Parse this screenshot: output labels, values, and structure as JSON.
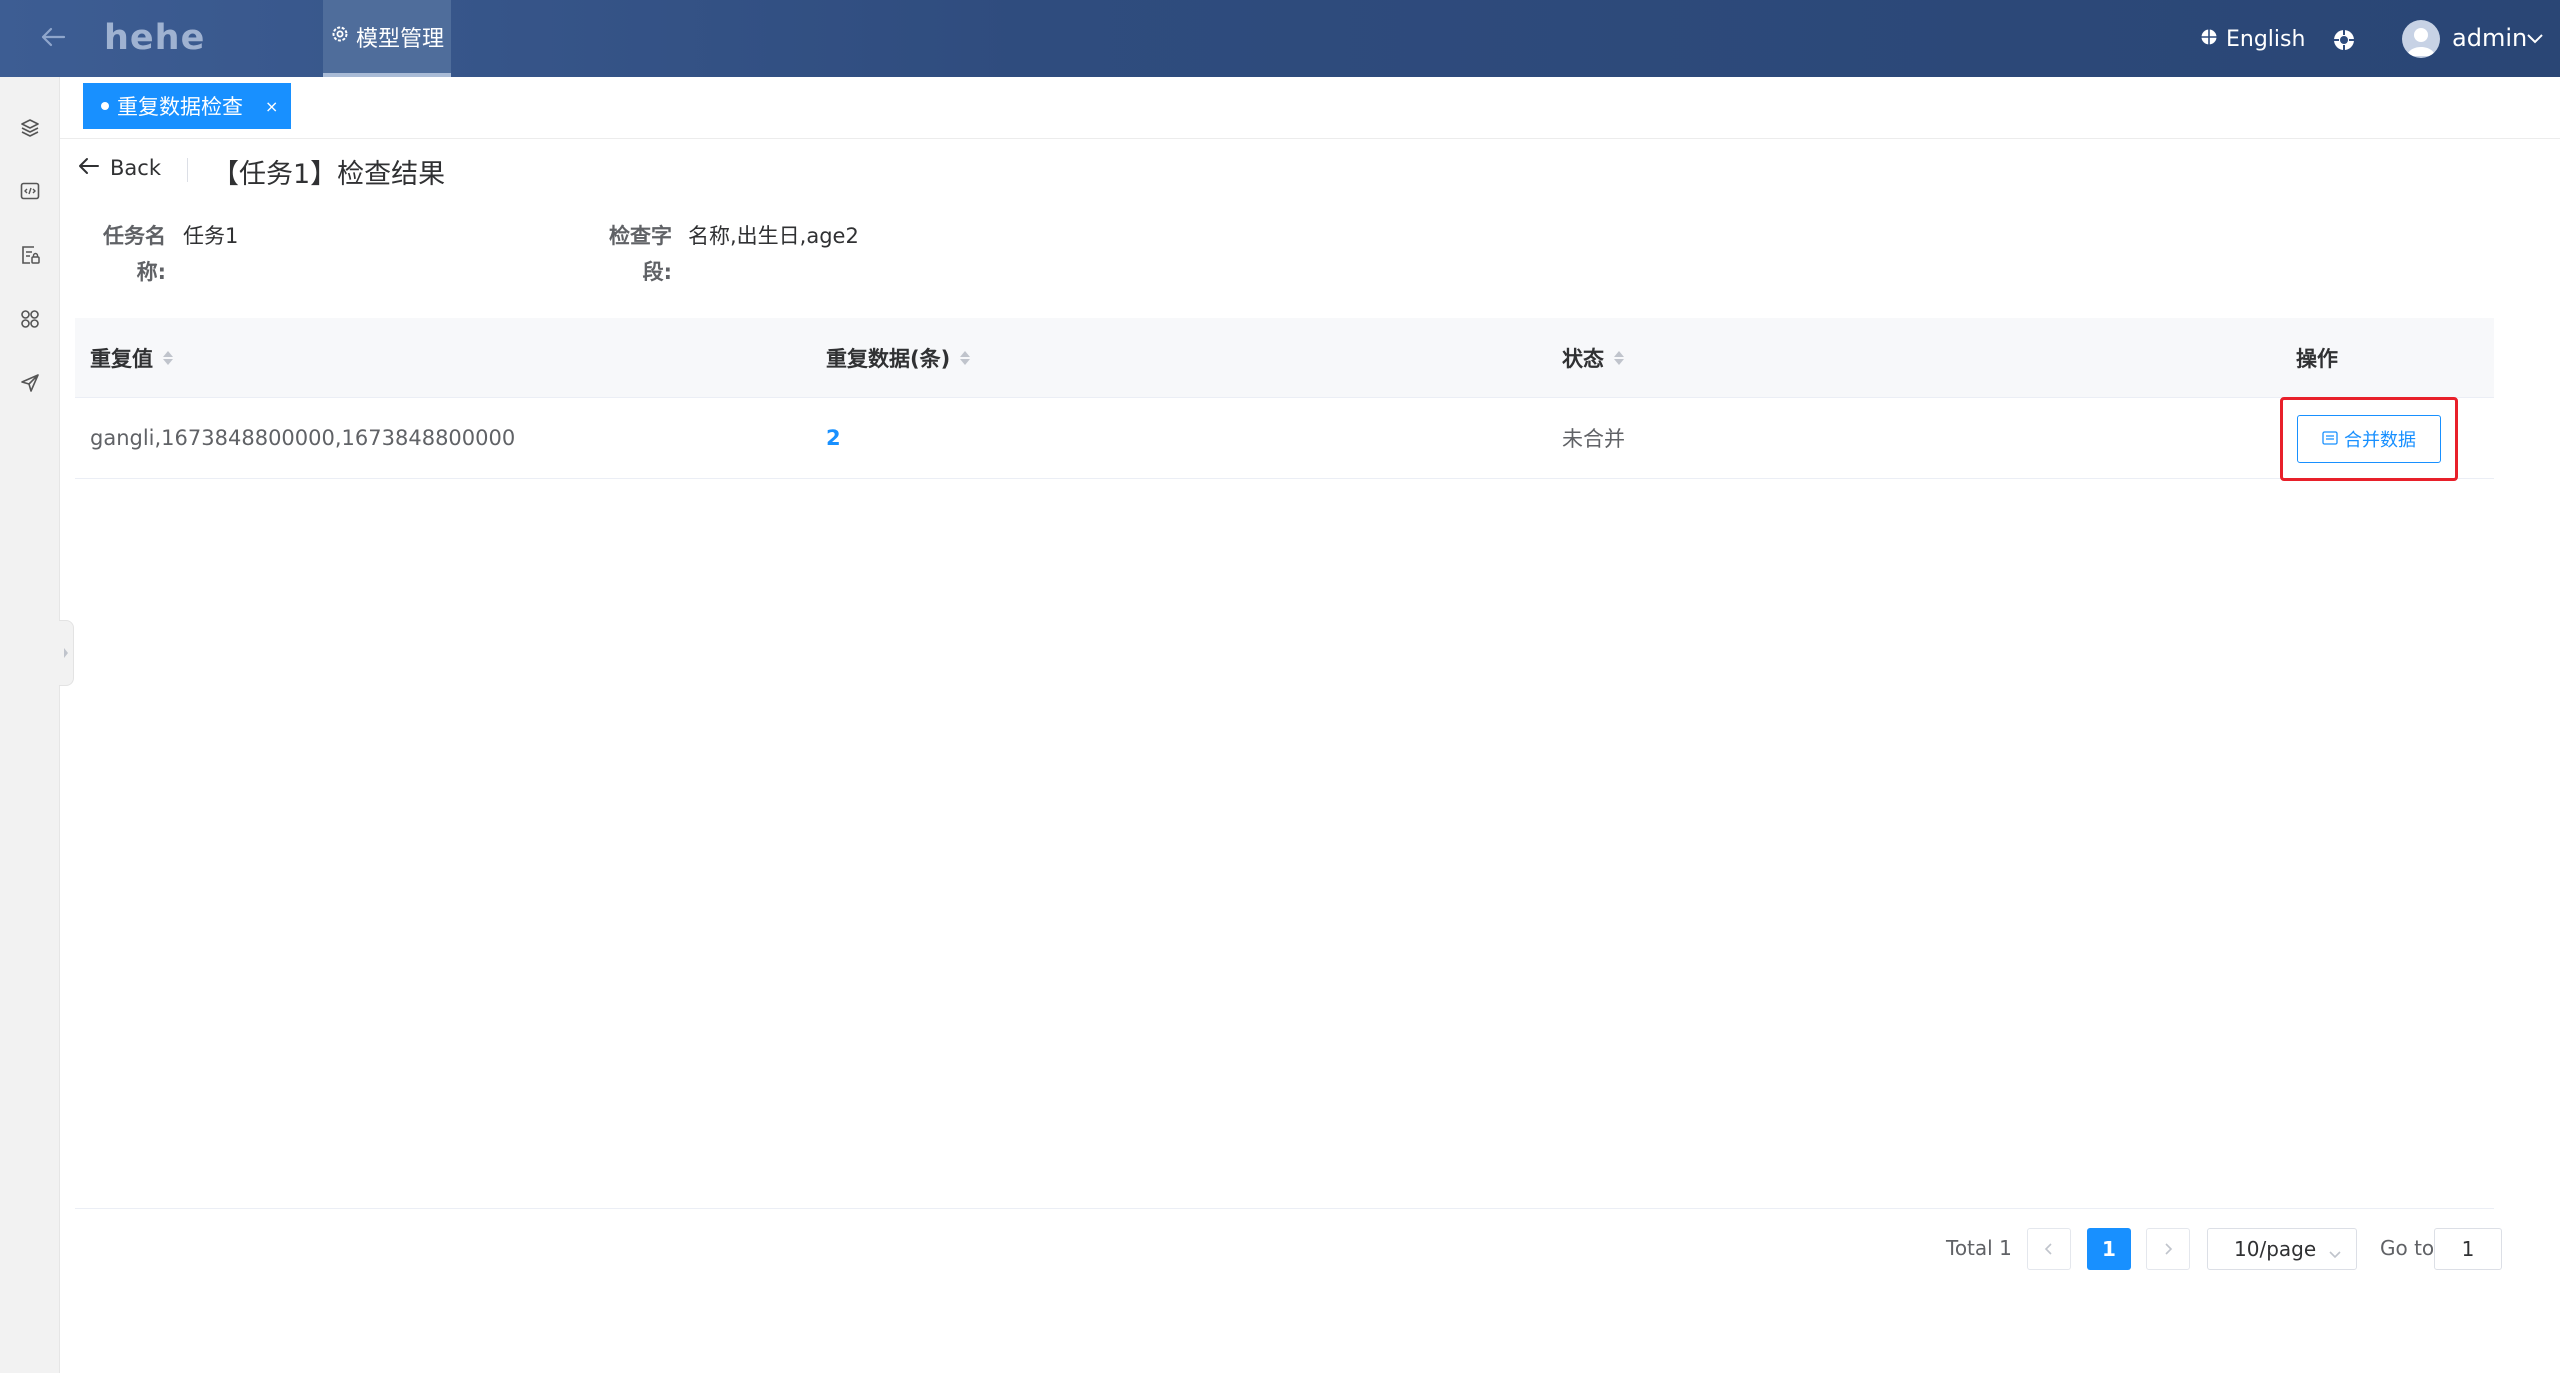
{
  "header": {
    "brand": "hehe",
    "nav_tab": "模型管理",
    "language": "English",
    "user_name": "admin"
  },
  "sidebar": {
    "icons": [
      "layers-icon",
      "code-icon",
      "document-lock-icon",
      "apps-grid-icon",
      "send-icon"
    ]
  },
  "tabs": [
    {
      "label": "重复数据检查",
      "close": "×"
    }
  ],
  "page": {
    "back_label": "Back",
    "title": "【任务1】检查结果"
  },
  "descriptions": [
    {
      "label_line1": "任务名",
      "label_line2": "称:",
      "value": "任务1"
    },
    {
      "label_line1": "检查字",
      "label_line2": "段:",
      "value": "名称,出生日,age2"
    }
  ],
  "table": {
    "columns": [
      "重复值",
      "重复数据(条)",
      "状态",
      "操作"
    ],
    "rows": [
      {
        "duplicate_value": "gangli,1673848800000,1673848800000",
        "duplicate_count": "2",
        "status": "未合并",
        "action_label": "合并数据"
      }
    ]
  },
  "pagination": {
    "total": "Total 1",
    "current_page": "1",
    "page_size": "10/page",
    "goto_label": "Go to",
    "goto_value": "1"
  },
  "colors": {
    "header_bg": "#2f4c7e",
    "primary": "#1890ff",
    "highlight": "#e8202a"
  }
}
